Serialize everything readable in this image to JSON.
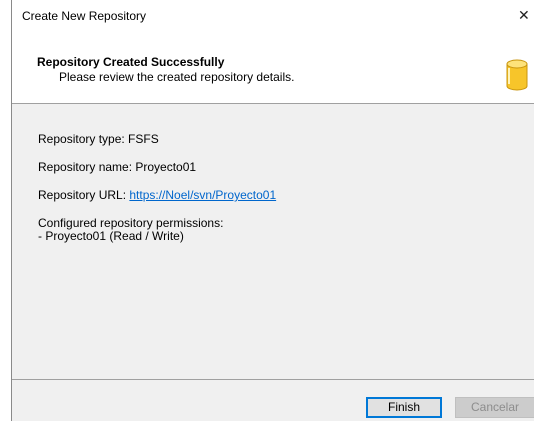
{
  "window": {
    "title": "Create New Repository",
    "close_glyph": "✕"
  },
  "header": {
    "title": "Repository Created Successfully",
    "subtitle": "Please review the created repository details.",
    "icon": "database-icon"
  },
  "details": {
    "type_line": "Repository type: FSFS",
    "name_line": "Repository name: Proyecto01",
    "url_label": "Repository URL: ",
    "url_value": "https://Noel/svn/Proyecto01",
    "permissions_label": "Configured repository permissions:",
    "permissions_item": "- Proyecto01 (Read / Write)"
  },
  "buttons": {
    "finish": "Finish",
    "cancel": "Cancelar"
  },
  "colors": {
    "link": "#0066cc",
    "db_icon_fill": "#f7c52a",
    "focus_border": "#0078d7"
  }
}
